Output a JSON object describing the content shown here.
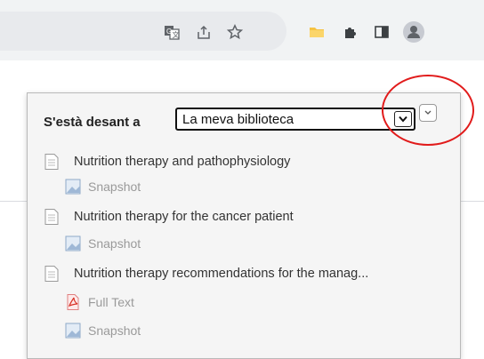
{
  "toolbar": {
    "icons": [
      "translate-icon",
      "share-icon",
      "star-icon",
      "folder-icon",
      "extensions-icon",
      "side-panel-icon",
      "profile-icon"
    ]
  },
  "popup": {
    "save_label": "S'està desant a",
    "library_select": "La meva biblioteca",
    "items": [
      {
        "title": "Nutrition therapy and pathophysiology",
        "attachments": [
          "Snapshot"
        ]
      },
      {
        "title": "Nutrition therapy for the cancer patient",
        "attachments": [
          "Snapshot"
        ]
      },
      {
        "title": "Nutrition therapy recommendations for the manag...",
        "attachments": [
          "Full Text",
          "Snapshot"
        ]
      }
    ]
  },
  "colors": {
    "highlight_circle": "#e11b1b",
    "toolbar_bg": "#f1f3f4"
  }
}
